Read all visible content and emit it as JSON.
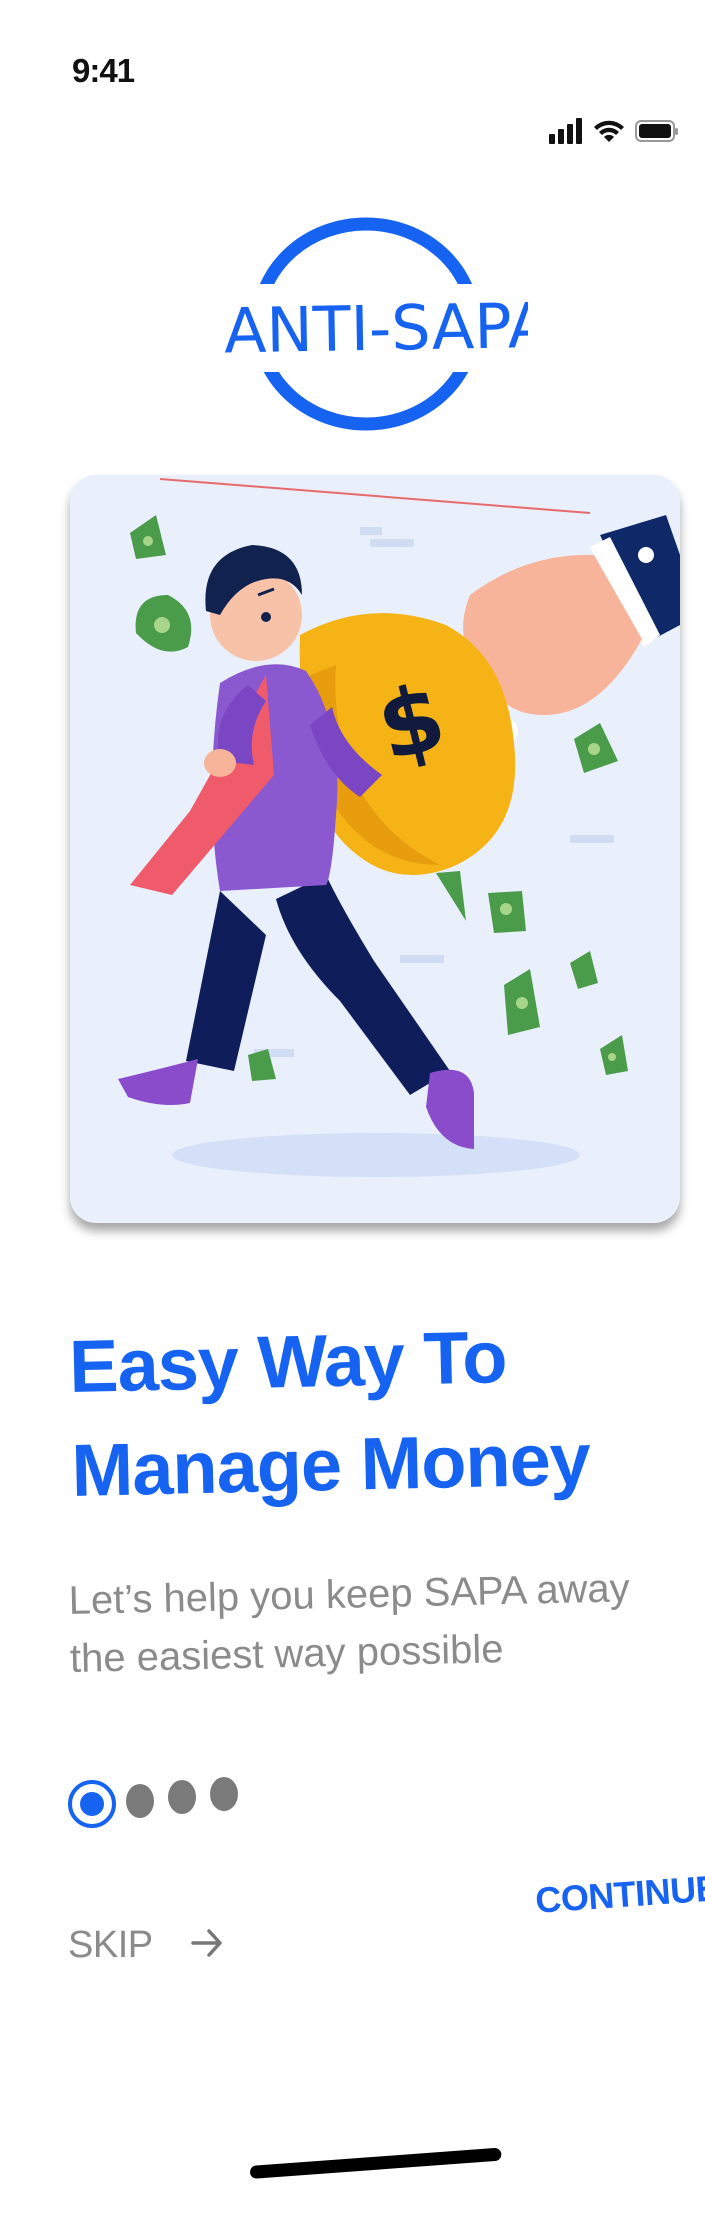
{
  "status_bar": {
    "time": "9:41",
    "icons": [
      "cellular-signal-icon",
      "wifi-icon",
      "battery-icon"
    ]
  },
  "logo": {
    "text": "ANTI-SAPA",
    "color": "#1663f2"
  },
  "illustration": {
    "subject": "man carrying money bag with hand pulling it away",
    "bag_symbol": "$"
  },
  "onboarding": {
    "title_line1": "Easy Way To",
    "title_line2": "Manage Money",
    "subtitle": "Let’s help you keep SAPA away the easiest way possible",
    "page_count": 4,
    "active_page": 1
  },
  "actions": {
    "skip_label": "SKIP",
    "continue_label": "CONTINUE"
  },
  "colors": {
    "accent": "#1663f2",
    "muted_text": "#8b8b8b",
    "card_background": "#e9f0fc"
  }
}
